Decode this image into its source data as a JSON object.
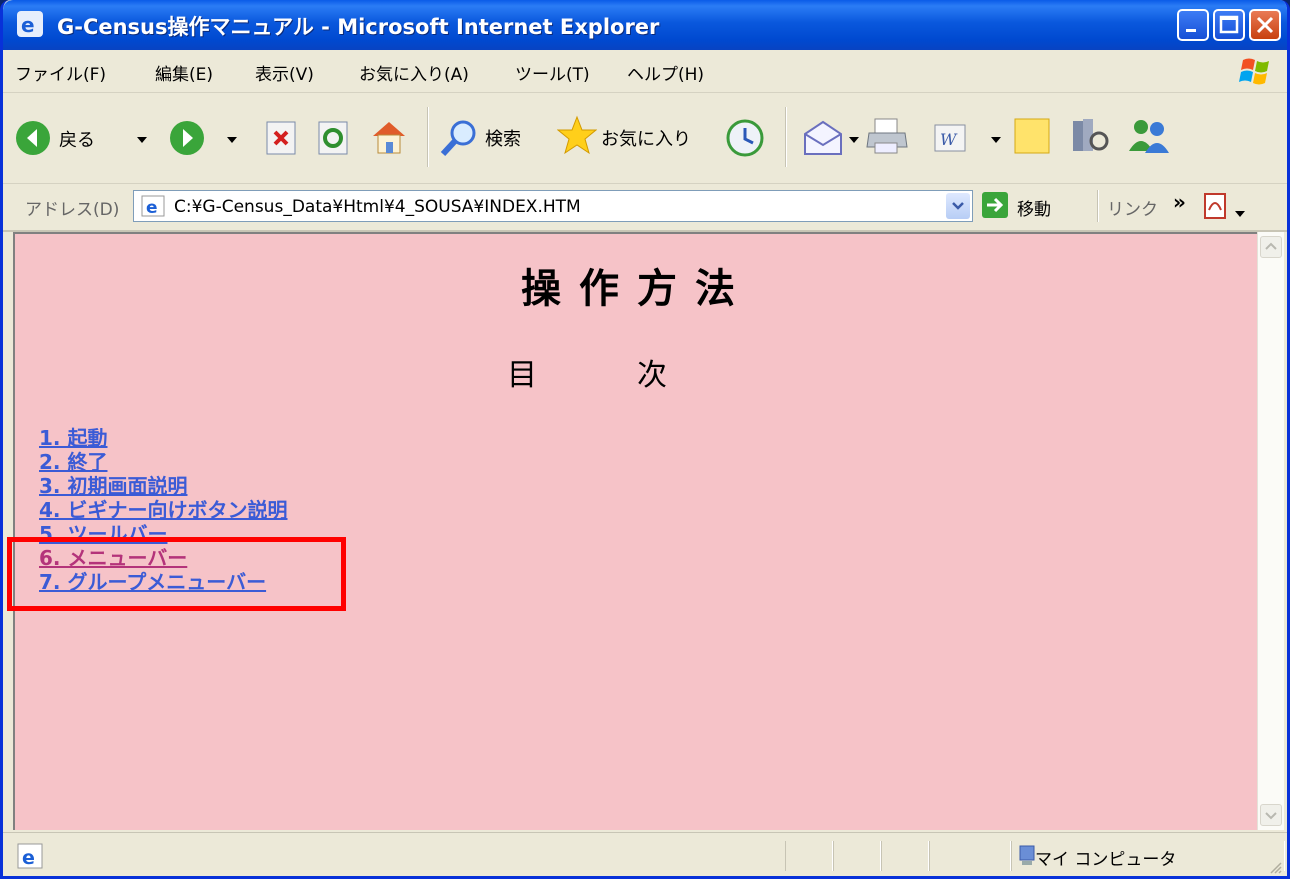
{
  "window": {
    "title": "G-Census操作マニュアル - Microsoft Internet Explorer"
  },
  "menu": [
    "ファイル(F)",
    "編集(E)",
    "表示(V)",
    "お気に入り(A)",
    "ツール(T)",
    "ヘルプ(H)"
  ],
  "toolbar": {
    "back_label": "戻る",
    "search_label": "検索",
    "favorites_label": "お気に入り"
  },
  "address": {
    "label": "アドレス(D)",
    "value": "C:¥G-Census_Data¥Html¥4_SOUSA¥INDEX.HTM",
    "go_label": "移動",
    "links_label": "リンク"
  },
  "page": {
    "title": "操作方法",
    "toc_title": "目次",
    "toc": [
      {
        "label": "1. 起動",
        "visited": false
      },
      {
        "label": "2. 終了",
        "visited": false
      },
      {
        "label": "3. 初期画面説明",
        "visited": false
      },
      {
        "label": "4. ビギナー向けボタン説明",
        "visited": false
      },
      {
        "label": "5. ツールバー",
        "visited": false
      },
      {
        "label": "6. メニューバー",
        "visited": true
      },
      {
        "label": "7. グループメニューバー",
        "visited": false
      }
    ]
  },
  "status": {
    "zone": "マイ コンピュータ"
  },
  "colors": {
    "content_bg": "#f6c3c8",
    "link": "#3b5bd6",
    "visited_link": "#b4337a",
    "highlight": "#ff0000",
    "titlebar": "#0a58dd"
  }
}
